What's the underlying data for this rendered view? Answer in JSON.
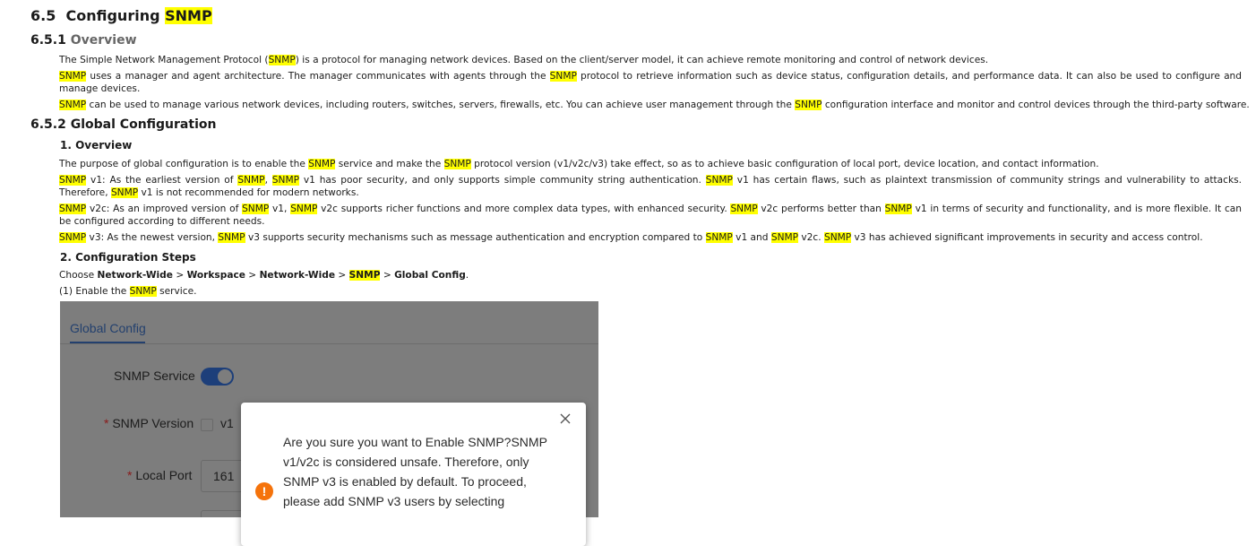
{
  "section": {
    "num": "6.5",
    "title_pre": "Configuring ",
    "title_hl": "SNMP"
  },
  "overview": {
    "num": "6.5.1",
    "title": "Overview",
    "p1": {
      "a": "The Simple Network Management Protocol (",
      "hl": "SNMP",
      "b": ") is a protocol for managing network devices. Based on the client/server model, it can achieve remote monitoring and control of network devices."
    },
    "p2": {
      "hl1": "SNMP",
      "a": " uses a manager and agent architecture. The manager communicates with agents through the ",
      "hl2": "SNMP",
      "b": " protocol to retrieve information such as device status, configuration details, and performance data. It can also be used to configure and manage devices."
    },
    "p3": {
      "hl1": "SNMP",
      "a": " can be used to manage various network devices, including routers, switches, servers, firewalls, etc. You can achieve user management through the ",
      "hl2": "SNMP",
      "b": " configuration interface and monitor and control devices through the third-party software."
    }
  },
  "global": {
    "num": "6.5.2",
    "title": "Global Configuration",
    "sub1": "1.  Overview",
    "p1": {
      "a": "The purpose of global configuration is to enable the ",
      "hl1": "SNMP",
      "b": " service and make the ",
      "hl2": "SNMP",
      "c": " protocol version (v1/v2c/v3) take effect, so as to achieve basic configuration of local port, device location, and contact information."
    },
    "p2": {
      "hl1": "SNMP",
      "a": " v1: As the earliest version of ",
      "hl2": "SNMP",
      "b": ", ",
      "hl3": "SNMP",
      "c": " v1 has poor security, and only supports simple community string authentication. ",
      "hl4": "SNMP",
      "d": " v1 has certain flaws, such as plaintext transmission of community strings and vulnerability to attacks. Therefore, ",
      "hl5": "SNMP",
      "e": " v1 is not recommended for modern networks."
    },
    "p3": {
      "hl1": "SNMP",
      "a": " v2c: As an improved version of ",
      "hl2": "SNMP",
      "b": " v1, ",
      "hl3": "SNMP",
      "c": " v2c supports richer functions and more complex data types, with enhanced security. ",
      "hl4": "SNMP",
      "d": " v2c performs better than ",
      "hl5": "SNMP",
      "e": " v1 in terms of security and functionality, and is more flexible. It can be configured according to different needs."
    },
    "p4": {
      "hl1": "SNMP",
      "a": " v3: As the newest version, ",
      "hl2": "SNMP",
      "b": " v3 supports security mechanisms such as message authentication and encryption compared to ",
      "hl3": "SNMP",
      "c": " v1 and ",
      "hl4": "SNMP",
      "d": " v2c. ",
      "hl5": "SNMP",
      "e": " v3 has achieved significant improvements in security and access control."
    },
    "sub2": "2.  Configuration Steps",
    "choose": {
      "a": "Choose ",
      "n1": "Network-Wide",
      "sep1": " > ",
      "n2": "Workspace",
      "sep2": " > ",
      "n3": "Network-Wide",
      "sep3": " > ",
      "n4": "SNMP",
      "sep4": " > ",
      "n5": "Global Config",
      "end": "."
    },
    "step1": {
      "a": "(1) Enable the ",
      "hl": "SNMP",
      "b": " service."
    }
  },
  "figure": {
    "tab": "Global Config",
    "service_label": "SNMP Service",
    "service_on": true,
    "version_label": "SNMP Version",
    "version_opt": "v1",
    "port_label": "Local Port",
    "port_value": "161",
    "req_mark": "*",
    "dialog": {
      "text": "Are you sure you want to Enable SNMP?SNMP v1/v2c is considered unsafe. Therefore, only SNMP v3 is enabled by default. To proceed, please add SNMP v3 users by selecting",
      "icon": "exclamation-icon",
      "warn_glyph": "!"
    },
    "colors": {
      "overlay": "#7d7d7d",
      "accent": "#23406e",
      "toggle_on": "#1d3f7a",
      "warn": "#f5730b",
      "highlight": "#ffff00"
    }
  }
}
